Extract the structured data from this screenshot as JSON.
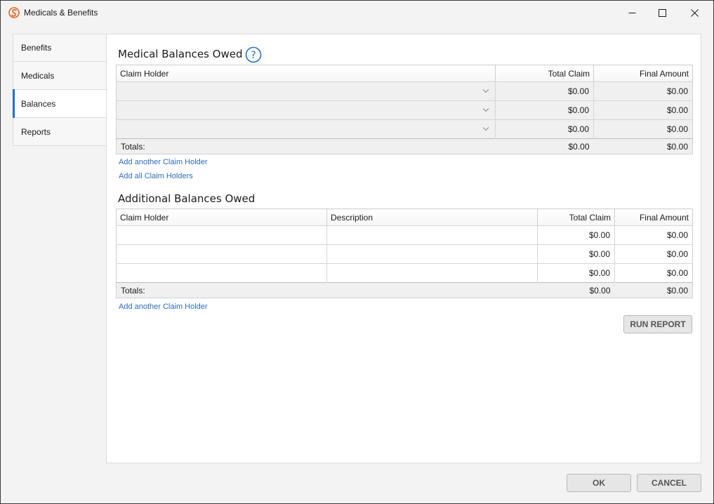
{
  "window": {
    "title": "Medicals & Benefits",
    "accent_color": "#1e73c8",
    "icon": "app-logo-icon"
  },
  "sidebar": {
    "items": [
      {
        "label": "Benefits"
      },
      {
        "label": "Medicals"
      },
      {
        "label": "Balances",
        "active": true
      },
      {
        "label": "Reports"
      }
    ]
  },
  "medical": {
    "title": "Medical Balances Owed",
    "columns": [
      "Claim Holder",
      "Total Claim",
      "Final Amount"
    ],
    "rows": [
      {
        "claim_holder": "",
        "total_claim": "$0.00",
        "final_amount": "$0.00"
      },
      {
        "claim_holder": "",
        "total_claim": "$0.00",
        "final_amount": "$0.00"
      },
      {
        "claim_holder": "",
        "total_claim": "$0.00",
        "final_amount": "$0.00"
      }
    ],
    "totals": {
      "label": "Totals:",
      "total_claim": "$0.00",
      "final_amount": "$0.00"
    },
    "links": {
      "add_another": "Add another Claim Holder",
      "add_all": "Add all Claim Holders"
    }
  },
  "additional": {
    "title": "Additional Balances Owed",
    "columns": [
      "Claim Holder",
      "Description",
      "Total Claim",
      "Final Amount"
    ],
    "rows": [
      {
        "claim_holder": "",
        "description": "",
        "total_claim": "$0.00",
        "final_amount": "$0.00"
      },
      {
        "claim_holder": "",
        "description": "",
        "total_claim": "$0.00",
        "final_amount": "$0.00"
      },
      {
        "claim_holder": "",
        "description": "",
        "total_claim": "$0.00",
        "final_amount": "$0.00"
      }
    ],
    "totals": {
      "label": "Totals:",
      "total_claim": "$0.00",
      "final_amount": "$0.00"
    },
    "links": {
      "add_another": "Add another Claim Holder"
    }
  },
  "buttons": {
    "run_report": "RUN REPORT",
    "ok": "OK",
    "cancel": "CANCEL"
  }
}
